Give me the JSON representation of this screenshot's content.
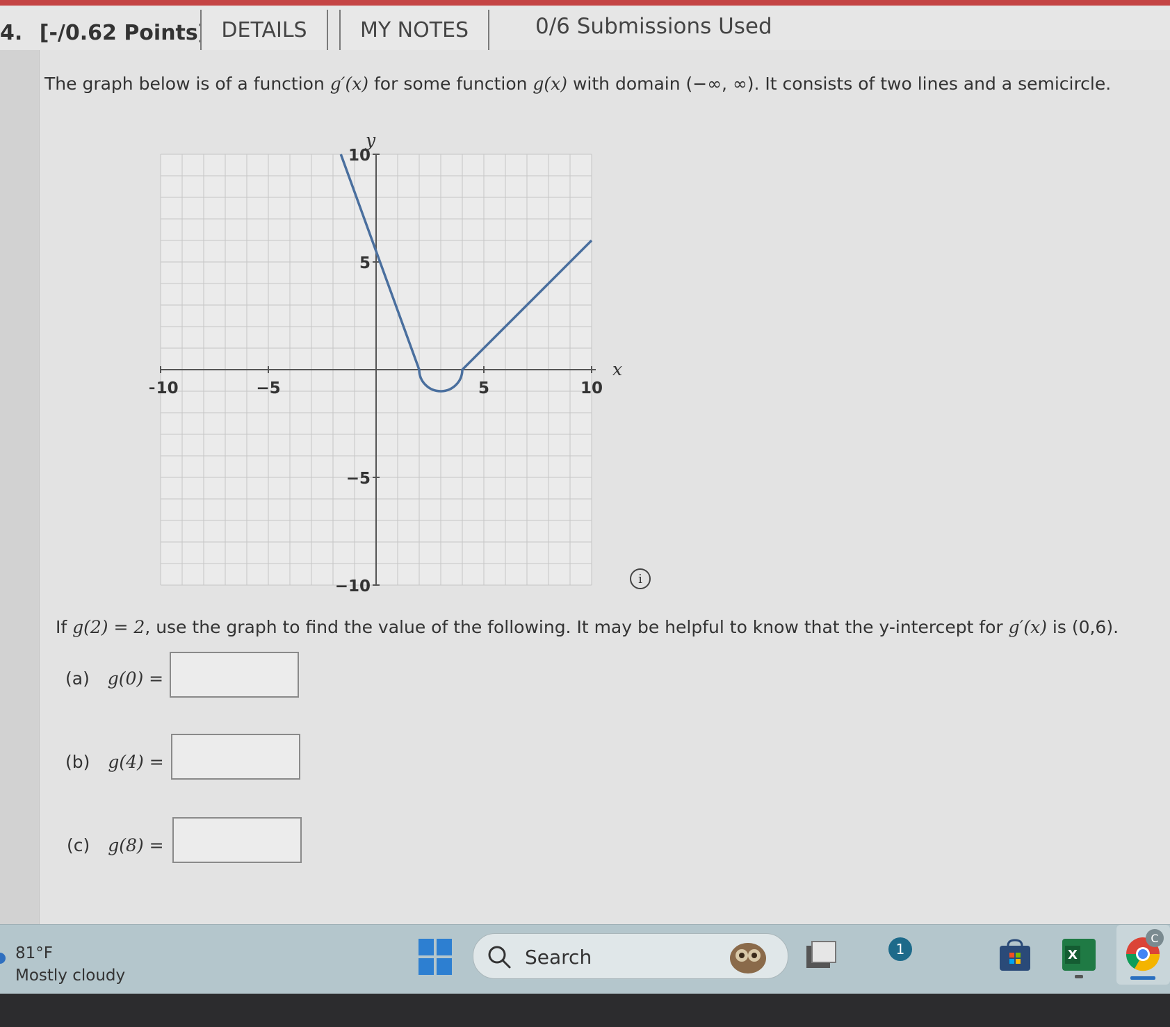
{
  "header": {
    "question_number": "4.",
    "points": "[-/0.62 Points]",
    "details_label": "DETAILS",
    "notes_label": "MY NOTES",
    "submissions": "0/6 Submissions Used"
  },
  "problem": {
    "intro_a": "The graph below is of a function ",
    "intro_fn1": "g′(x)",
    "intro_b": " for some function ",
    "intro_fn2": "g(x)",
    "intro_c": " with domain (−∞, ∞). It consists of two lines and a semicircle.",
    "question_a": "If ",
    "question_eq": "g(2) = 2",
    "question_b": ", use the graph to find the value of the following. It may be helpful to know that the y-intercept for ",
    "question_fn": "g′(x)",
    "question_c": " is (0,6).",
    "parts": [
      {
        "label": "(a)",
        "expr": "g(0) =",
        "value": ""
      },
      {
        "label": "(b)",
        "expr": "g(4) =",
        "value": ""
      },
      {
        "label": "(c)",
        "expr": "g(8) =",
        "value": ""
      }
    ],
    "info_glyph": "i"
  },
  "chart_data": {
    "type": "line",
    "xlabel": "x",
    "ylabel": "y",
    "xlim": [
      -10,
      10
    ],
    "ylim": [
      -10,
      10
    ],
    "grid": true,
    "x_ticks": [
      -10,
      -5,
      5,
      10
    ],
    "y_ticks": [
      10,
      5,
      -5,
      -10
    ],
    "x_tick_labels": [
      "−10",
      "−5",
      "5",
      "10"
    ],
    "y_tick_labels": [
      "10",
      "5",
      "−5",
      "−10"
    ],
    "series": [
      {
        "segments": [
          {
            "kind": "line",
            "from": [
              -2,
              11
            ],
            "to": [
              2,
              0
            ]
          },
          {
            "kind": "semicircle",
            "center": [
              3,
              0
            ],
            "radius": 1,
            "side": "below"
          },
          {
            "kind": "line",
            "from": [
              4,
              0
            ],
            "to": [
              10,
              6
            ]
          }
        ],
        "color": "#4a6f9e"
      }
    ]
  },
  "taskbar": {
    "weather_temp": "81°F",
    "weather_desc": "Mostly cloudy",
    "search_label": "Search",
    "notification_count": "1",
    "excel_letter": "X",
    "profile_letter": "C"
  }
}
